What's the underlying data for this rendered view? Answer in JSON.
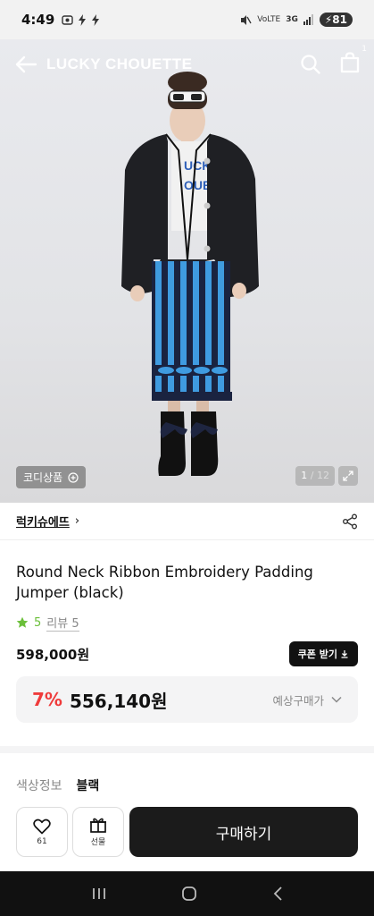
{
  "status_bar": {
    "time": "4:49",
    "network": "3G",
    "battery": "81"
  },
  "header": {
    "brand": "LUCKY CHOUETTE",
    "cart_count": "1"
  },
  "hero": {
    "coordi_label": "코디상품",
    "page_current": "1",
    "page_total": "12"
  },
  "product": {
    "brand_name": "럭키슈에뜨",
    "title": "Round Neck Ribbon Embroidery Padding Jumper (black)",
    "rating": "5",
    "review_label": "리뷰 5",
    "original_price": "598,000원",
    "coupon_label": "쿠폰 받기",
    "discount_pct": "7%",
    "discount_price": "556,140원",
    "expected_label": "예상구매가",
    "color_label": "색상정보",
    "color_value": "블랙"
  },
  "actions": {
    "like_count": "61",
    "gift_label": "선물",
    "buy_label": "구매하기"
  },
  "colors": {
    "accent_red": "#ef3b3b",
    "rating_green": "#6bbf3a",
    "buy_bg": "#1b1b1b"
  }
}
